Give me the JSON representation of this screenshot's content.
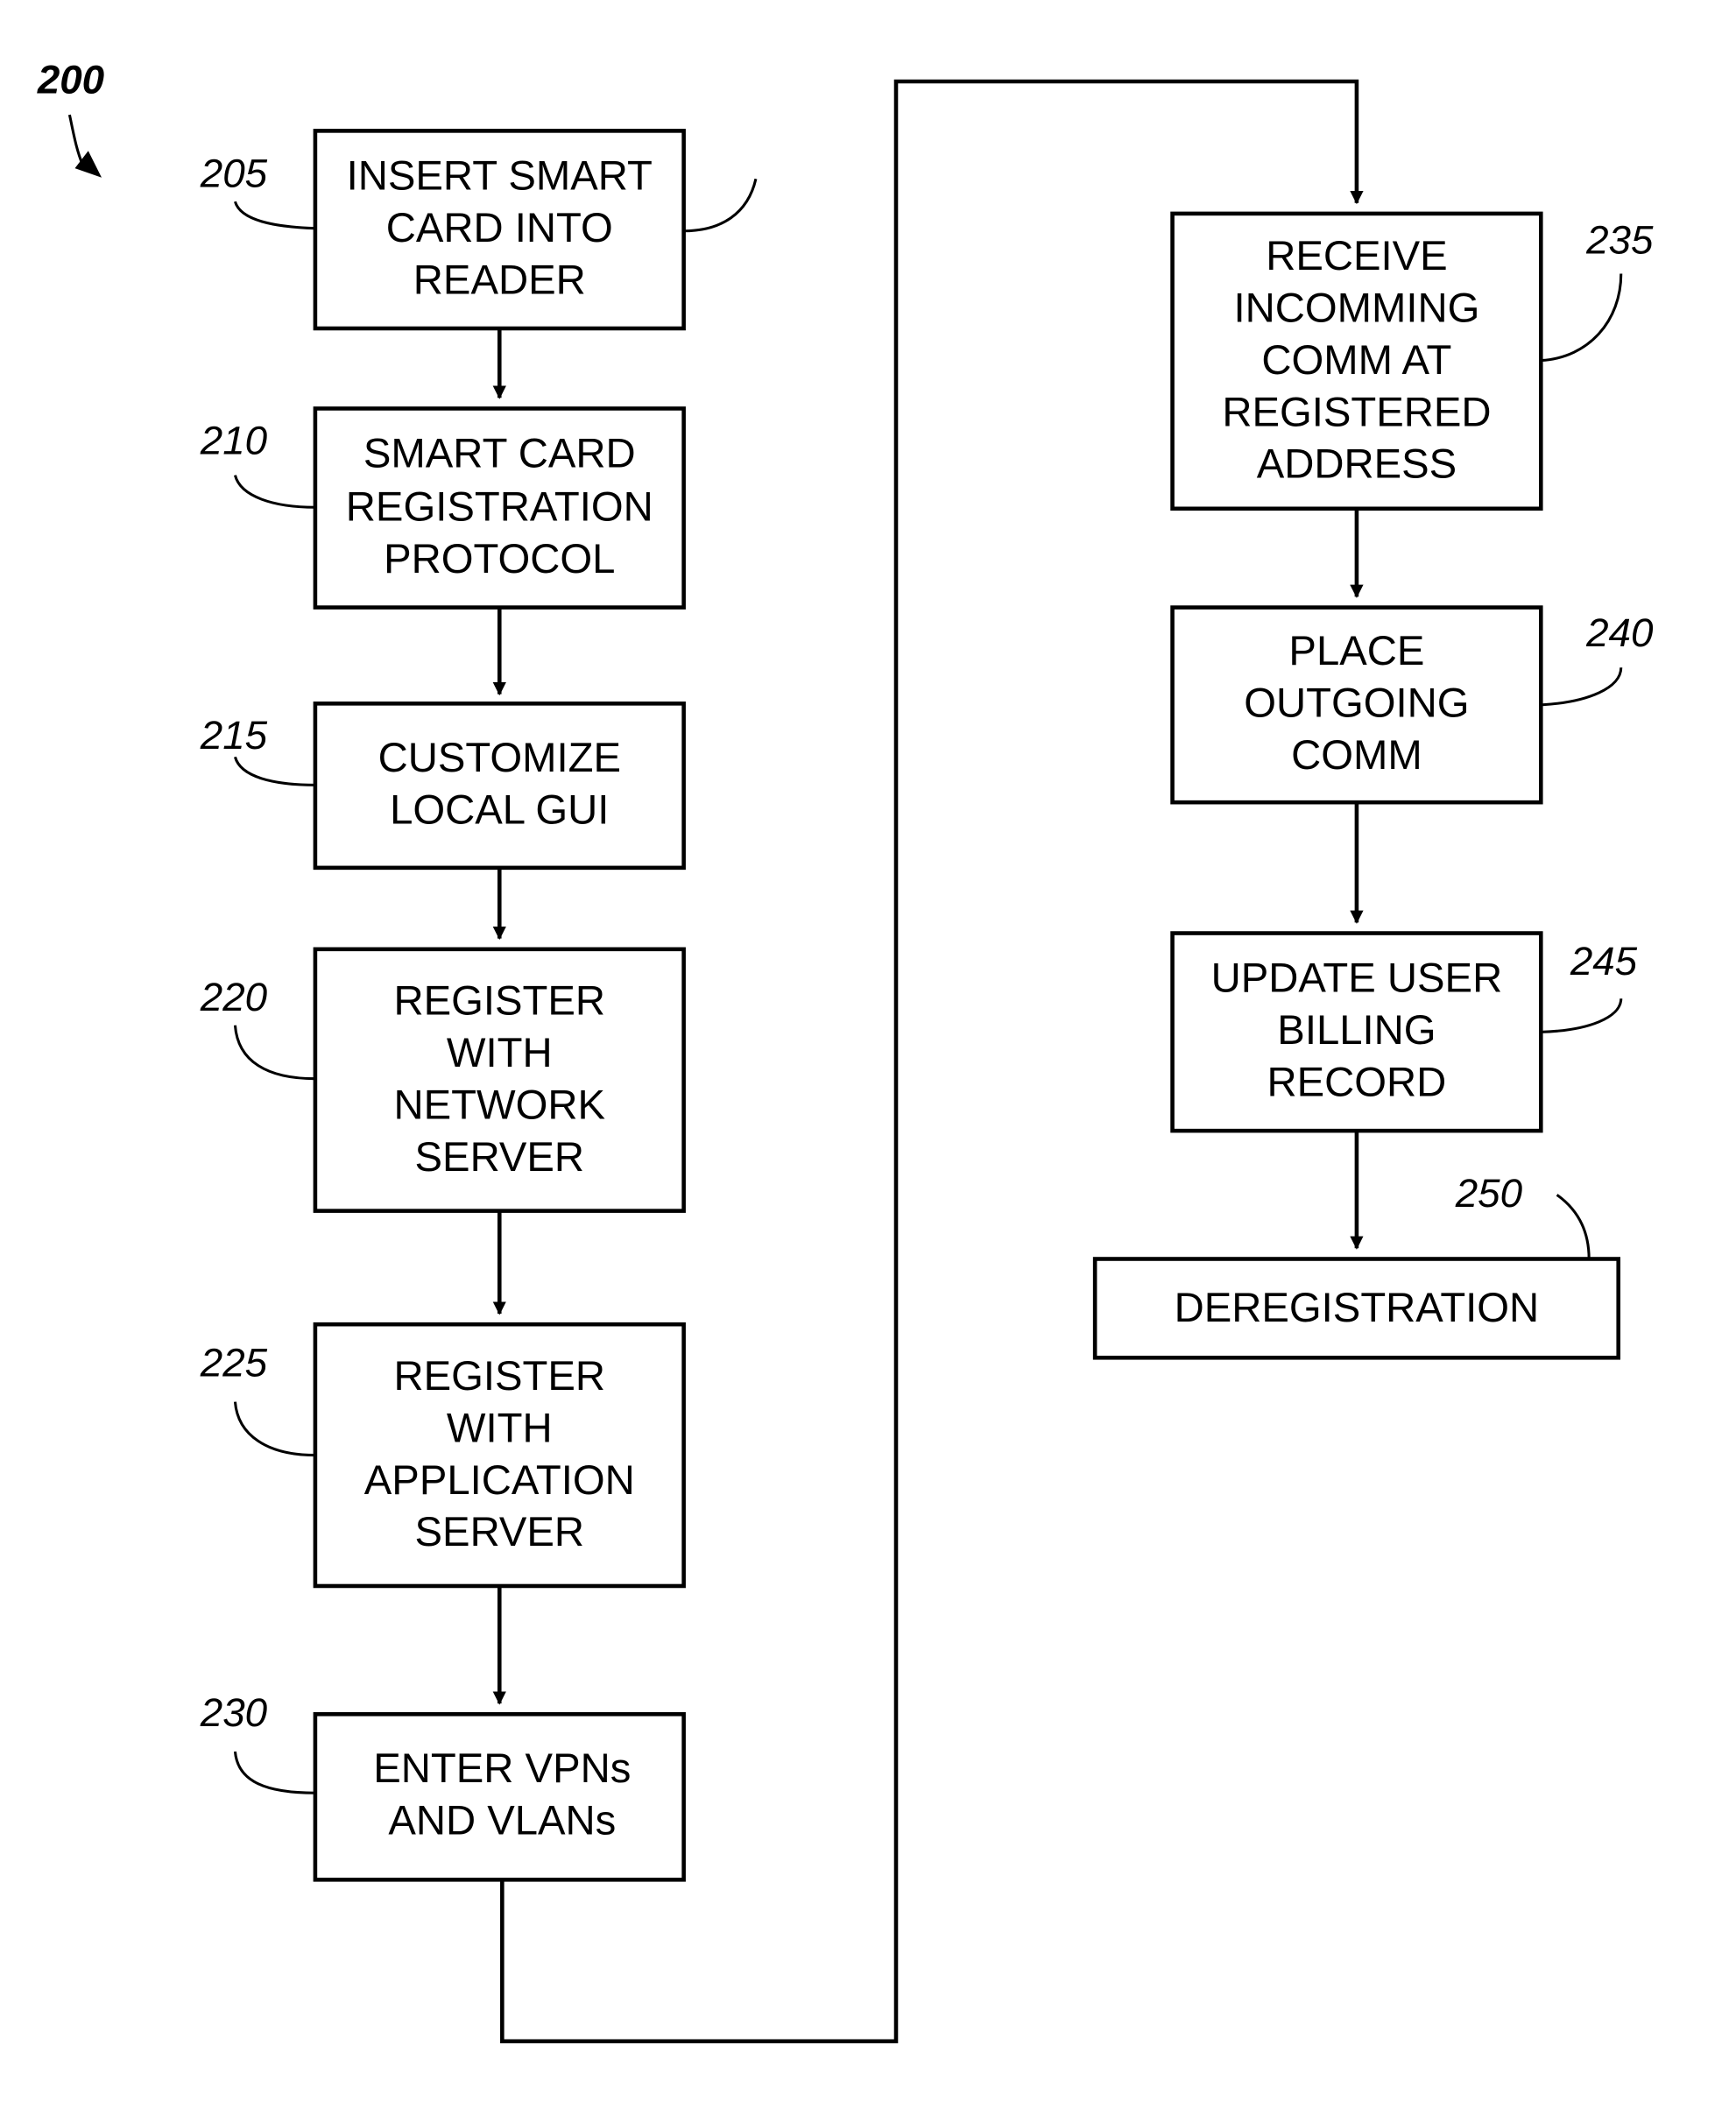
{
  "figure": {
    "reference": "200"
  },
  "steps": [
    {
      "ref": "205",
      "lines": [
        "INSERT SMART",
        "CARD INTO",
        "READER"
      ]
    },
    {
      "ref": "210",
      "lines": [
        "SMART CARD",
        "REGISTRATION",
        "PROTOCOL"
      ]
    },
    {
      "ref": "215",
      "lines": [
        "CUSTOMIZE",
        "LOCAL GUI"
      ]
    },
    {
      "ref": "220",
      "lines": [
        "REGISTER",
        "WITH",
        "NETWORK",
        "SERVER"
      ]
    },
    {
      "ref": "225",
      "lines": [
        "REGISTER",
        "WITH",
        "APPLICATION",
        "SERVER"
      ]
    },
    {
      "ref": "230",
      "lines": [
        "ENTER VPNs",
        "AND VLANs"
      ]
    },
    {
      "ref": "235",
      "lines": [
        "RECEIVE",
        "INCOMMING",
        "COMM AT",
        "REGISTERED",
        "ADDRESS"
      ]
    },
    {
      "ref": "240",
      "lines": [
        "PLACE",
        "OUTGOING",
        "COMM"
      ]
    },
    {
      "ref": "245",
      "lines": [
        "UPDATE USER",
        "BILLING",
        "RECORD"
      ]
    },
    {
      "ref": "250",
      "lines": [
        "DEREGISTRATION"
      ]
    }
  ],
  "colors": {
    "stroke": "#000000",
    "background": "#ffffff"
  }
}
